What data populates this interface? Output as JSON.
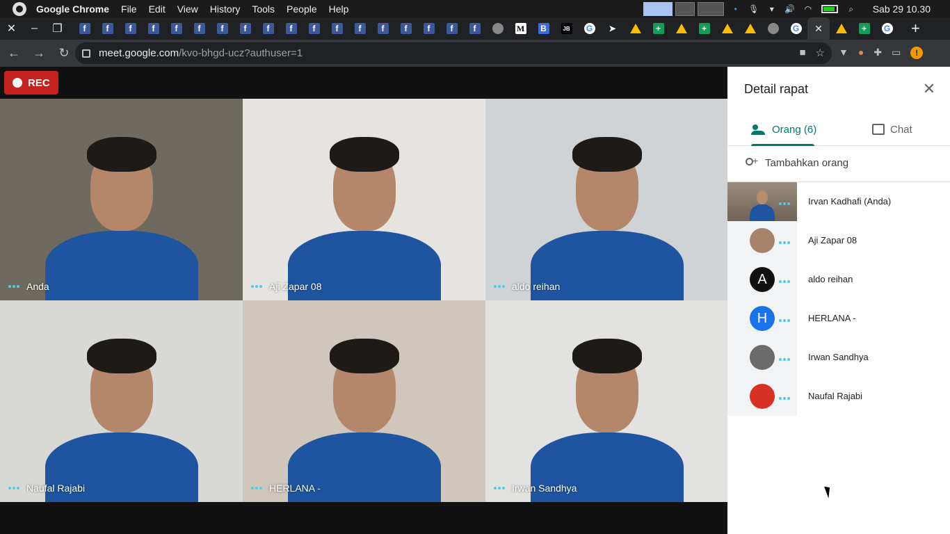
{
  "system": {
    "app_name": "Google Chrome",
    "menus": [
      "File",
      "Edit",
      "View",
      "History",
      "Tools",
      "People",
      "Help"
    ],
    "clock": "Sab 29 10.30"
  },
  "tabs": {
    "favicons": [
      "facebook",
      "facebook",
      "facebook",
      "facebook",
      "facebook",
      "facebook",
      "facebook",
      "facebook",
      "facebook",
      "facebook",
      "facebook",
      "facebook",
      "facebook",
      "facebook",
      "facebook",
      "facebook",
      "facebook",
      "facebook",
      "globe",
      "medium",
      "blogger",
      "jetbrains",
      "google",
      "arrow",
      "drive",
      "sheets",
      "drive",
      "sheets",
      "drive",
      "drive",
      "globe",
      "google",
      "meet-active",
      "drive",
      "sheets",
      "google"
    ],
    "active_close": "✕",
    "new_tab": "+"
  },
  "address": {
    "host": "meet.google.com",
    "path": "/kvo-bhgd-ucz?authuser=1"
  },
  "meet": {
    "rec_label": "REC",
    "tiles": [
      {
        "name": "Anda",
        "bg": "#6f6a5f"
      },
      {
        "name": "Aji Zapar 08",
        "bg": "#e6e4e0"
      },
      {
        "name": "aldo reihan",
        "bg": "#cfd3d6"
      },
      {
        "name": "Naufal Rajabi",
        "bg": "#d8d8d4"
      },
      {
        "name": "HERLANA -",
        "bg": "#cfc6bc"
      },
      {
        "name": "Irwan Sandhya",
        "bg": "#e2e2e0"
      }
    ]
  },
  "panel": {
    "title": "Detail rapat",
    "tab_people": "Orang (6)",
    "tab_chat": "Chat",
    "add_people": "Tambahkan orang",
    "participants": [
      {
        "name": "Irvan Kadhafi (Anda)",
        "type": "video"
      },
      {
        "name": "Aji Zapar 08",
        "type": "photo",
        "color": "#a8836c"
      },
      {
        "name": "aldo reihan",
        "type": "letter",
        "letter": "A",
        "color": "#111111"
      },
      {
        "name": "HERLANA -",
        "type": "letter",
        "letter": "H",
        "color": "#1a73e8"
      },
      {
        "name": "Irwan Sandhya",
        "type": "photo",
        "color": "#6b6b6b"
      },
      {
        "name": "Naufal Rajabi",
        "type": "photo",
        "color": "#d93025"
      }
    ]
  }
}
